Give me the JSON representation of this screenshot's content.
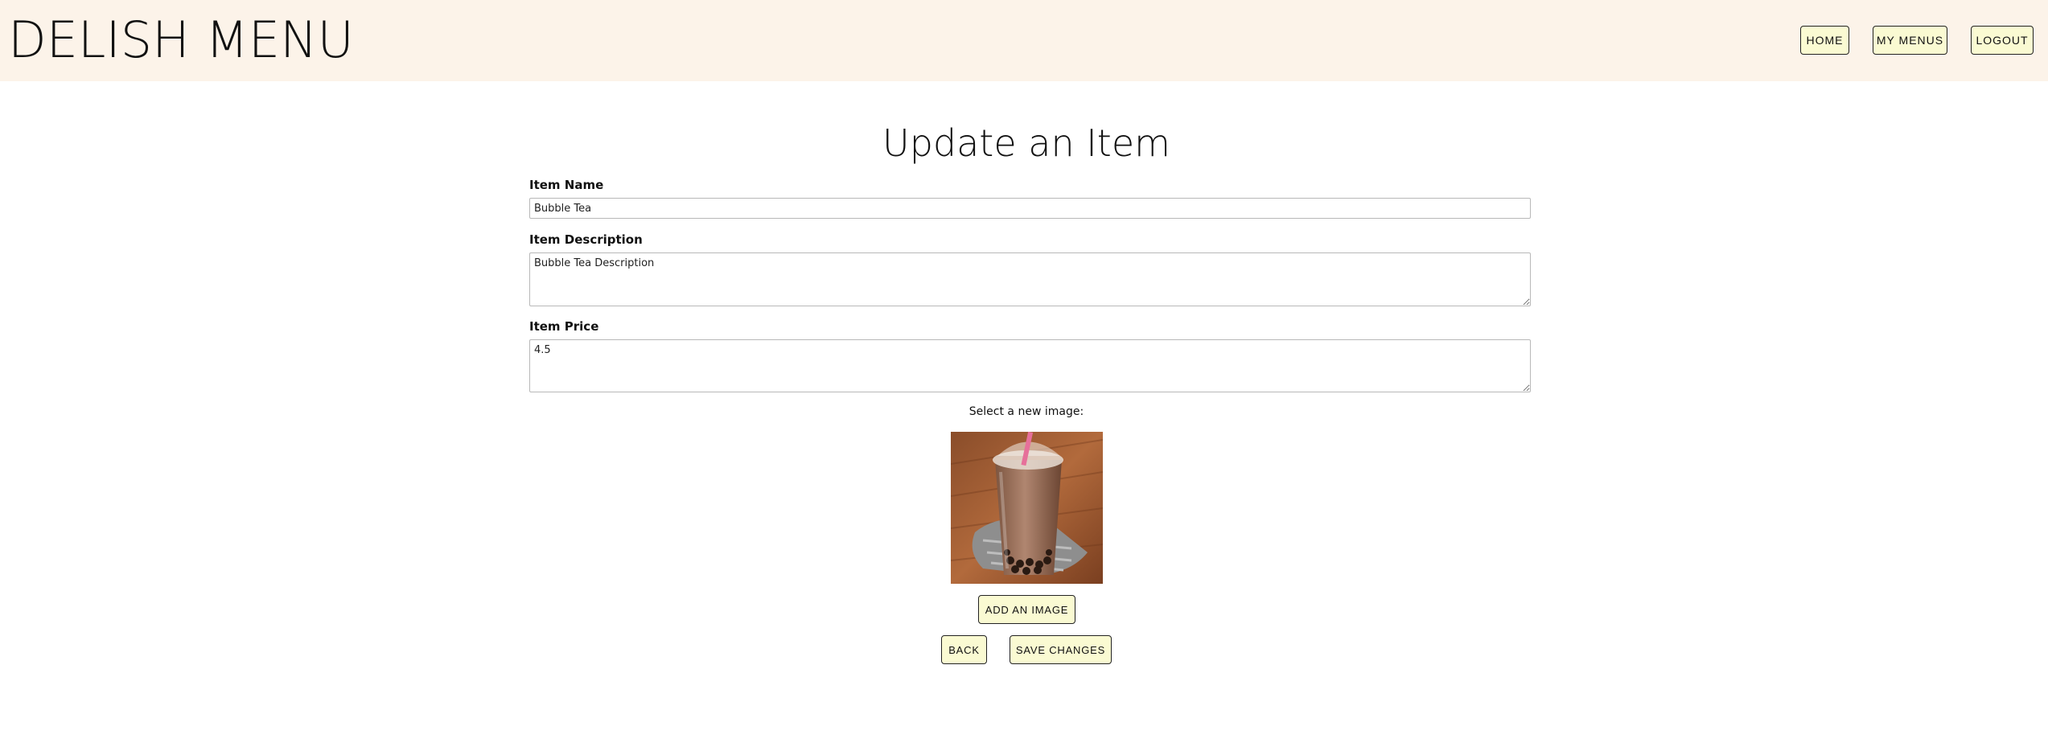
{
  "header": {
    "brand": "DELISH MENU",
    "nav": {
      "home": "HOME",
      "my_menus": "MY MENUS",
      "logout": "LOGOUT"
    }
  },
  "form": {
    "title": "Update an Item",
    "item_name": {
      "label": "Item Name",
      "value": "Bubble Tea"
    },
    "item_description": {
      "label": "Item Description",
      "value": "Bubble Tea Description"
    },
    "item_price": {
      "label": "Item Price",
      "value": "4.5"
    },
    "image": {
      "prompt": "Select a new image:",
      "icon": "bubble-tea-photo"
    },
    "buttons": {
      "add_image": "ADD AN IMAGE",
      "back": "BACK",
      "save": "SAVE CHANGES"
    }
  },
  "colors": {
    "header_bg": "#fcf3e9",
    "button_bg": "#fafad2",
    "button_border": "#222222"
  }
}
